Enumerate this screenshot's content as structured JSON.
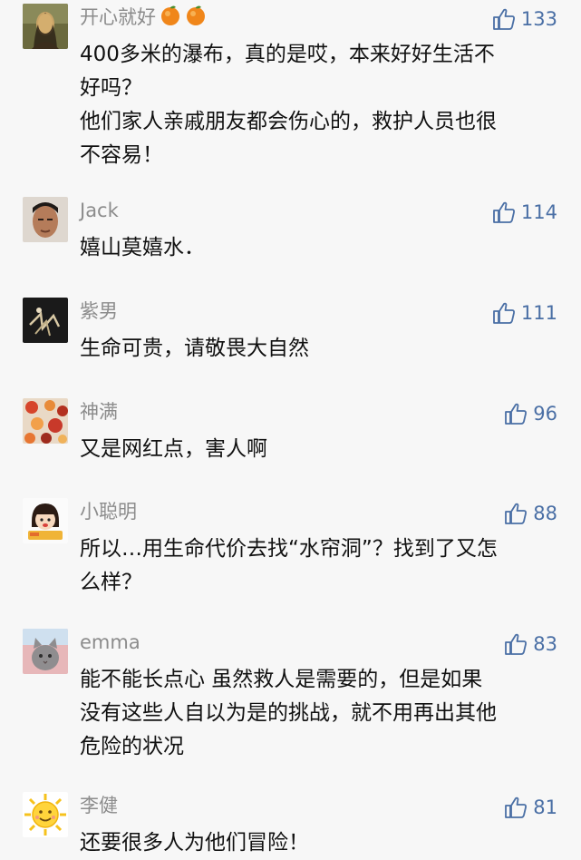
{
  "comments": [
    {
      "name": "开心就好",
      "likes": "133",
      "avatar": "mona-lisa-avatar",
      "emoji": [
        "orange-icon",
        "orange-icon"
      ],
      "lines": [
        "400多米的瀑布，真的是哎，本来好好生活不",
        "好吗？",
        "他们家人亲戚朋友都会伤心的，救护人员也很",
        "不容易！"
      ]
    },
    {
      "name": "Jack",
      "likes": "114",
      "avatar": "man-face-avatar",
      "lines": [
        "嬉山莫嬉水．"
      ]
    },
    {
      "name": "紫男",
      "likes": "111",
      "avatar": "dark-sketch-avatar",
      "lines": [
        "生命可贵，请敬畏大自然"
      ]
    },
    {
      "name": "神满",
      "likes": "96",
      "avatar": "colorful-pattern-avatar",
      "lines": [
        "又是网红点，害人啊"
      ]
    },
    {
      "name": "小聪明",
      "likes": "88",
      "avatar": "cartoon-girl-avatar",
      "lines": [
        "所以…用生命代价去找“水帘洞”？找到了又怎",
        "么样？"
      ]
    },
    {
      "name": "emma",
      "likes": "83",
      "avatar": "cat-avatar",
      "lines": [
        "能不能长点心 虽然救人是需要的，但是如果",
        "没有这些人自以为是的挑战，就不用再出其他",
        "危险的状况"
      ]
    },
    {
      "name": "李健",
      "likes": "81",
      "avatar": "sun-avatar",
      "lines": [
        "还要很多人为他们冒险！"
      ]
    }
  ],
  "colors": {
    "like": "#4a6fa5",
    "name": "#8c8c8c",
    "text": "#111111",
    "background": "#f7f7f7"
  }
}
